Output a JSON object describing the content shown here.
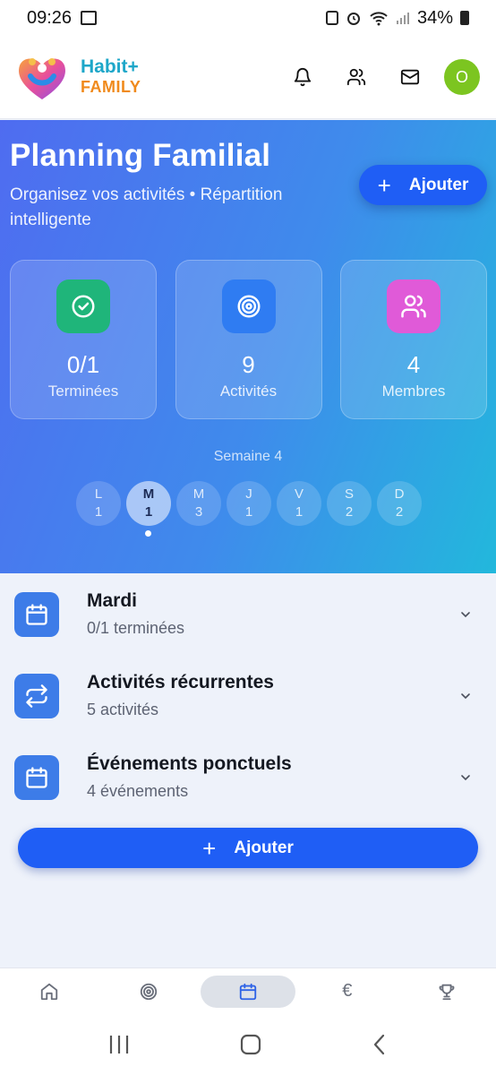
{
  "status_bar": {
    "time": "09:26",
    "battery": "34%"
  },
  "app": {
    "brand_line1": "Habit+",
    "brand_line2": "FAMILY",
    "avatar_initial": "O"
  },
  "hero": {
    "title": "Planning Familial",
    "subtitle": "Organisez vos activités • Répartition intelligente",
    "add_label": "Ajouter",
    "stats": [
      {
        "value": "0/1",
        "label": "Terminées",
        "icon": "check-circle-icon",
        "color": "#1fb57a"
      },
      {
        "value": "9",
        "label": "Activités",
        "icon": "target-icon",
        "color": "#2f7cf2"
      },
      {
        "value": "4",
        "label": "Membres",
        "icon": "users-icon",
        "color": "#e05ad8"
      }
    ],
    "week_label": "Semaine 4",
    "days": [
      {
        "letter": "L",
        "count": "1"
      },
      {
        "letter": "M",
        "count": "1",
        "active": true
      },
      {
        "letter": "M",
        "count": "3"
      },
      {
        "letter": "J",
        "count": "1"
      },
      {
        "letter": "V",
        "count": "1"
      },
      {
        "letter": "S",
        "count": "2"
      },
      {
        "letter": "D",
        "count": "2"
      }
    ]
  },
  "sections": [
    {
      "title": "Mardi",
      "subtitle": "0/1 terminées",
      "icon": "calendar-icon"
    },
    {
      "title": "Activités récurrentes",
      "subtitle": "5 activités",
      "icon": "repeat-icon"
    },
    {
      "title": "Événements ponctuels",
      "subtitle": "4 événements",
      "icon": "calendar-icon"
    }
  ],
  "main_add_label": "Ajouter",
  "bottom_nav": [
    {
      "name": "home-icon"
    },
    {
      "name": "target-icon"
    },
    {
      "name": "calendar-icon",
      "active": true
    },
    {
      "name": "euro-icon",
      "glyph": "€"
    },
    {
      "name": "trophy-icon"
    }
  ],
  "colors": {
    "accent": "#1f5ef5",
    "brand_blue": "#1ea7c9",
    "brand_orange": "#f08a1c",
    "avatar": "#7cc520"
  }
}
